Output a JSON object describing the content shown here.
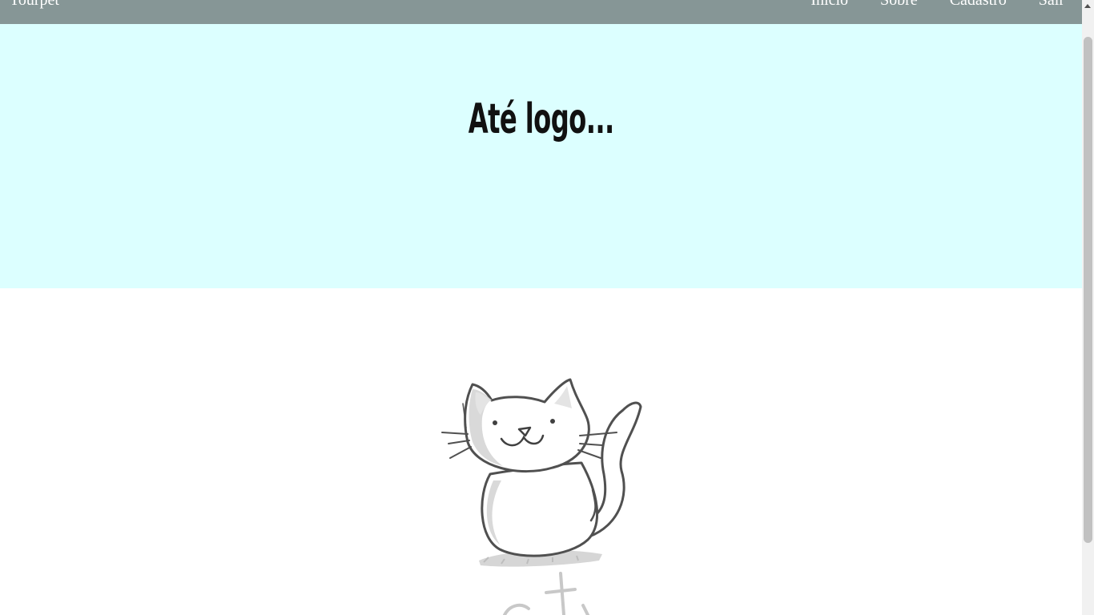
{
  "navbar": {
    "brand": "Tourpet",
    "links": [
      "Início",
      "Sobre",
      "Cadastro",
      "Sair"
    ]
  },
  "hero": {
    "title": "Até logo..."
  },
  "illustration": {
    "icon": "cartoon-cat-icon"
  },
  "colors": {
    "navbar_bg": "#869696",
    "hero_bg": "#dcffff",
    "text_light": "#ffffff",
    "title_text": "#111111"
  }
}
